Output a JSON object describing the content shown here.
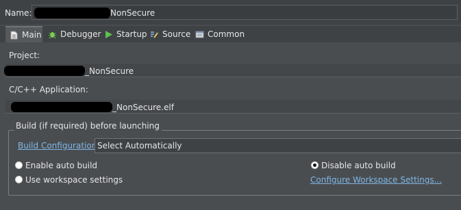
{
  "name": {
    "label": "Name:",
    "value_suffix": "NonSecure"
  },
  "tabs": [
    {
      "label": "Main",
      "icon": "main-file-icon"
    },
    {
      "label": "Debugger",
      "icon": "debugger-bug-icon"
    },
    {
      "label": "Startup",
      "icon": "startup-play-icon"
    },
    {
      "label": "Source",
      "icon": "source-icon"
    },
    {
      "label": "Common",
      "icon": "common-icon"
    }
  ],
  "project": {
    "label": "Project:",
    "value_suffix": "_NonSecure"
  },
  "application": {
    "label": "C/C++ Application:",
    "value_suffix": "_NonSecure.elf"
  },
  "build": {
    "group_title": "Build (if required) before launching",
    "config_link": "Build Configuration:",
    "config_value": "Select Automatically",
    "enable_auto_build": "Enable auto build",
    "disable_auto_build": "Disable auto build",
    "use_workspace": "Use workspace settings",
    "configure_link": "Configure Workspace Settings..."
  },
  "colors": {
    "accent_link": "#7fb7e6",
    "background": "#4a4d50"
  }
}
